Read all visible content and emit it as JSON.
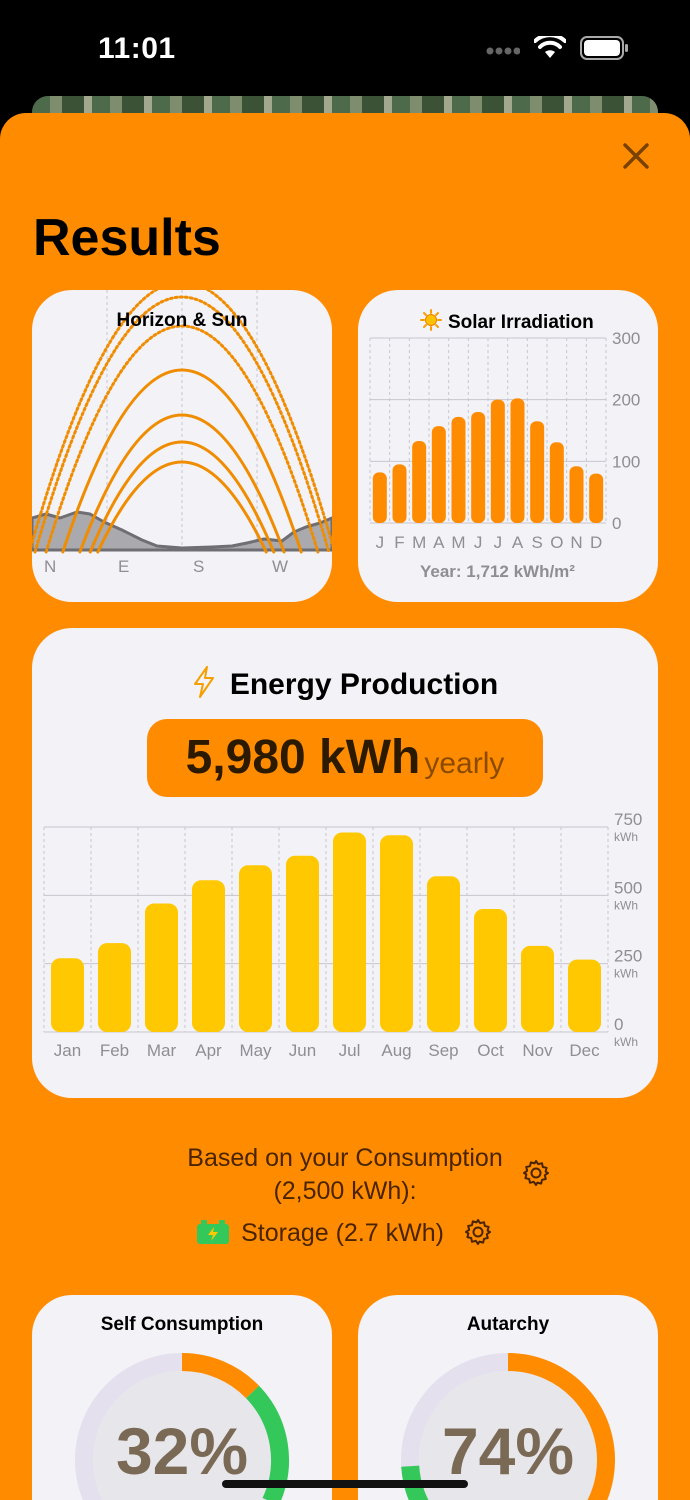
{
  "status_bar": {
    "time": "11:01"
  },
  "page": {
    "title": "Results"
  },
  "horizon_card": {
    "title": "Horizon & Sun",
    "directions": [
      "N",
      "E",
      "S",
      "W"
    ]
  },
  "irradiation_card": {
    "title": "Solar Irradiation",
    "icon": "sun-icon",
    "year_total": "Year: 1,712 kWh/m²"
  },
  "energy_card": {
    "title": "Energy Production",
    "icon": "lightning-icon",
    "value": "5,980 kWh",
    "period": "yearly"
  },
  "consumption": {
    "line1": "Based on your Consumption",
    "line2": "(2,500 kWh):",
    "storage_label": "Storage (2.7 kWh)"
  },
  "self_consumption": {
    "title": "Self Consumption",
    "value": "32%",
    "fraction": 0.32
  },
  "autarchy": {
    "title": "Autarchy",
    "value": "74%",
    "fraction": 0.74
  },
  "colors": {
    "accent": "#ff8c00",
    "card": "#f2f2f7",
    "bar_yellow": "#ffc800",
    "green": "#34c759"
  },
  "chart_data": [
    {
      "type": "bar",
      "title": "Solar Irradiation",
      "categories": [
        "J",
        "F",
        "M",
        "A",
        "M",
        "J",
        "J",
        "A",
        "S",
        "O",
        "N",
        "D"
      ],
      "values": [
        82,
        95,
        133,
        157,
        172,
        180,
        200,
        202,
        165,
        131,
        92,
        80
      ],
      "ylim": [
        0,
        300
      ],
      "yticks": [
        "300",
        "200",
        "100",
        "0"
      ],
      "annotation": "Year: 1,712 kWh/m²"
    },
    {
      "type": "bar",
      "title": "Energy Production",
      "categories": [
        "Jan",
        "Feb",
        "Mar",
        "Apr",
        "May",
        "Jun",
        "Jul",
        "Aug",
        "Sep",
        "Oct",
        "Nov",
        "Dec"
      ],
      "values": [
        270,
        325,
        470,
        555,
        610,
        645,
        730,
        720,
        570,
        450,
        315,
        265
      ],
      "ylim": [
        0,
        750
      ],
      "yticks": [
        "750",
        "500",
        "250",
        "0"
      ],
      "yunit": "kWh"
    },
    {
      "type": "line",
      "title": "Horizon & Sun",
      "categories": [
        "N",
        "E",
        "S",
        "W"
      ],
      "series": [
        {
          "values": [
            270
          ]
        },
        {
          "values": [
            255
          ]
        },
        {
          "values": [
            226
          ]
        },
        {
          "values": [
            182
          ]
        },
        {
          "values": [
            137
          ]
        },
        {
          "values": [
            110
          ]
        },
        {
          "values": [
            90
          ]
        }
      ]
    }
  ]
}
